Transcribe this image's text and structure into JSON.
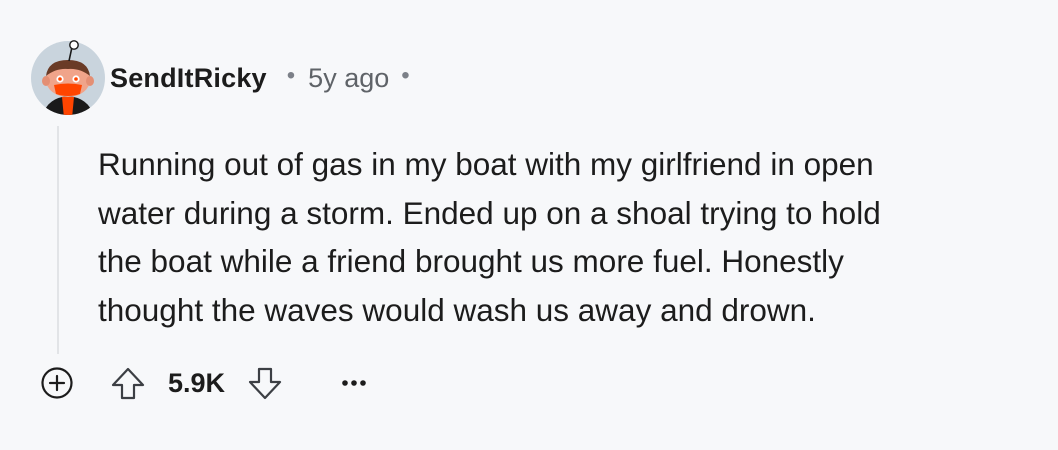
{
  "comment": {
    "author": {
      "username": "SendItRicky",
      "avatar_icon": "reddit-snoo-avatar-icon"
    },
    "timestamp": "5y ago",
    "separator": "•",
    "body": "Running out of gas in my boat with my girlfriend in open\nwater during a storm. Ended up on a shoal trying to hold\nthe boat while a friend brought us more fuel. Honestly\nthought the waves would wash us away and drown.",
    "actions": {
      "expand_icon": "plus-circle-icon",
      "upvote_icon": "arrow-up-icon",
      "score": "5.9K",
      "downvote_icon": "arrow-down-icon",
      "more_icon": "ellipsis-icon"
    }
  },
  "colors": {
    "background": "#f7f8fa",
    "text": "#1c1c1c",
    "muted": "#5f6368",
    "avatar_bg": "#c9d4dd",
    "avatar_accent": "#ff4500",
    "thread_line": "#e2e4e7"
  }
}
